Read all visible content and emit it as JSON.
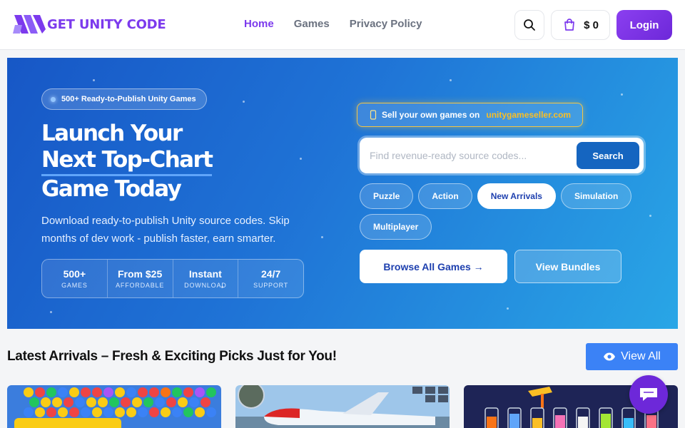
{
  "brand": {
    "name": "GET UNITY CODE",
    "accent": "#7c3aed"
  },
  "nav": {
    "items": [
      {
        "label": "Home",
        "active": true
      },
      {
        "label": "Games"
      },
      {
        "label": "Privacy Policy"
      }
    ]
  },
  "header": {
    "cart_amount": "$ 0",
    "login_label": "Login",
    "search_icon": "search-icon",
    "cart_icon": "cart-icon"
  },
  "hero": {
    "badge": "500+ Ready-to-Publish Unity Games",
    "headline": [
      "Launch Your",
      "Next Top-Chart",
      "Game Today"
    ],
    "description": "Download ready-to-publish Unity source codes. Skip months of dev work - publish faster, earn smarter.",
    "stats": [
      {
        "value": "500+",
        "label": "GAMES"
      },
      {
        "value": "From $25",
        "label": "AFFORDABLE"
      },
      {
        "value": "Instant",
        "label": "DOWNLOAD"
      },
      {
        "value": "24/7",
        "label": "SUPPORT"
      }
    ],
    "sell": {
      "icon": "phone-icon",
      "text": "Sell your own games on",
      "link": "unitygameseller.com"
    },
    "search": {
      "placeholder": "Find revenue-ready source codes...",
      "button": "Search"
    },
    "chips": [
      {
        "label": "Puzzle"
      },
      {
        "label": "Action"
      },
      {
        "label": "New Arrivals",
        "active": true
      },
      {
        "label": "Simulation"
      },
      {
        "label": "Multiplayer"
      }
    ],
    "browse_label": "Browse All Games →",
    "bundles_label": "View Bundles"
  },
  "section": {
    "title": "Latest Arrivals – Fresh & Exciting Picks Just for You!",
    "view_all": "View All"
  },
  "cards": [
    {
      "theme": "bubble-shooter"
    },
    {
      "theme": "airplane"
    },
    {
      "theme": "water-sort"
    }
  ],
  "chat": {
    "icon": "chat-icon"
  }
}
